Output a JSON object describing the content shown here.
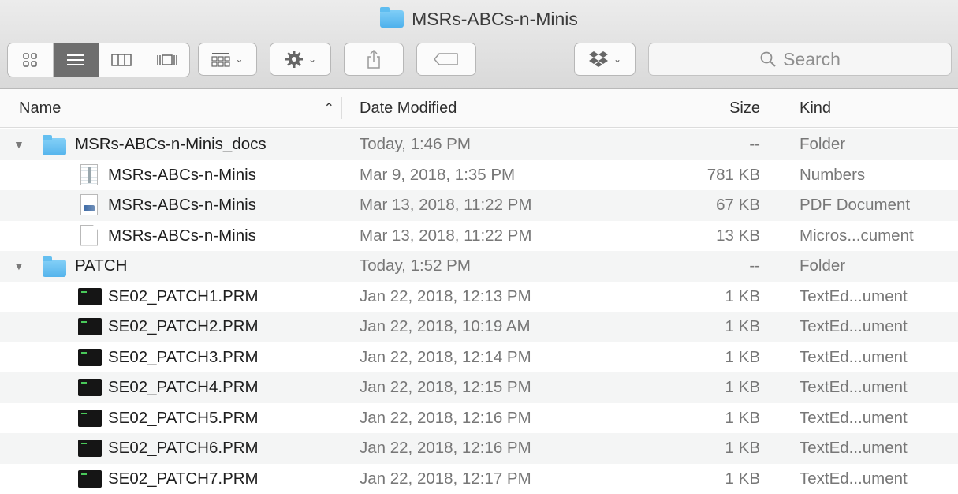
{
  "window": {
    "title": "MSRs-ABCs-n-Minis"
  },
  "toolbar": {
    "search_placeholder": "Search"
  },
  "columns": {
    "name": "Name",
    "date": "Date Modified",
    "size": "Size",
    "kind": "Kind"
  },
  "rows": [
    {
      "name": "MSRs-ABCs-n-Minis_docs",
      "date": "Today, 1:46 PM",
      "size": "--",
      "kind": "Folder",
      "icon": "folder-icon",
      "indent": 0,
      "expanded": true
    },
    {
      "name": "MSRs-ABCs-n-Minis",
      "date": "Mar 9, 2018, 1:35 PM",
      "size": "781 KB",
      "kind": "Numbers",
      "icon": "numbers-document-icon",
      "indent": 1
    },
    {
      "name": "MSRs-ABCs-n-Minis",
      "date": "Mar 13, 2018, 11:22 PM",
      "size": "67 KB",
      "kind": "PDF Document",
      "icon": "pdf-document-icon",
      "indent": 1
    },
    {
      "name": "MSRs-ABCs-n-Minis",
      "date": "Mar 13, 2018, 11:22 PM",
      "size": "13 KB",
      "kind": "Micros...cument",
      "icon": "blank-document-icon",
      "indent": 1
    },
    {
      "name": "PATCH",
      "date": "Today, 1:52 PM",
      "size": "--",
      "kind": "Folder",
      "icon": "folder-icon",
      "indent": 0,
      "expanded": true
    },
    {
      "name": "SE02_PATCH1.PRM",
      "date": "Jan 22, 2018, 12:13 PM",
      "size": "1 KB",
      "kind": "TextEd...ument",
      "icon": "terminal-document-icon",
      "indent": 1
    },
    {
      "name": "SE02_PATCH2.PRM",
      "date": "Jan 22, 2018, 10:19 AM",
      "size": "1 KB",
      "kind": "TextEd...ument",
      "icon": "terminal-document-icon",
      "indent": 1
    },
    {
      "name": "SE02_PATCH3.PRM",
      "date": "Jan 22, 2018, 12:14 PM",
      "size": "1 KB",
      "kind": "TextEd...ument",
      "icon": "terminal-document-icon",
      "indent": 1
    },
    {
      "name": "SE02_PATCH4.PRM",
      "date": "Jan 22, 2018, 12:15 PM",
      "size": "1 KB",
      "kind": "TextEd...ument",
      "icon": "terminal-document-icon",
      "indent": 1
    },
    {
      "name": "SE02_PATCH5.PRM",
      "date": "Jan 22, 2018, 12:16 PM",
      "size": "1 KB",
      "kind": "TextEd...ument",
      "icon": "terminal-document-icon",
      "indent": 1
    },
    {
      "name": "SE02_PATCH6.PRM",
      "date": "Jan 22, 2018, 12:16 PM",
      "size": "1 KB",
      "kind": "TextEd...ument",
      "icon": "terminal-document-icon",
      "indent": 1
    },
    {
      "name": "SE02_PATCH7.PRM",
      "date": "Jan 22, 2018, 12:17 PM",
      "size": "1 KB",
      "kind": "TextEd...ument",
      "icon": "terminal-document-icon",
      "indent": 1
    }
  ]
}
